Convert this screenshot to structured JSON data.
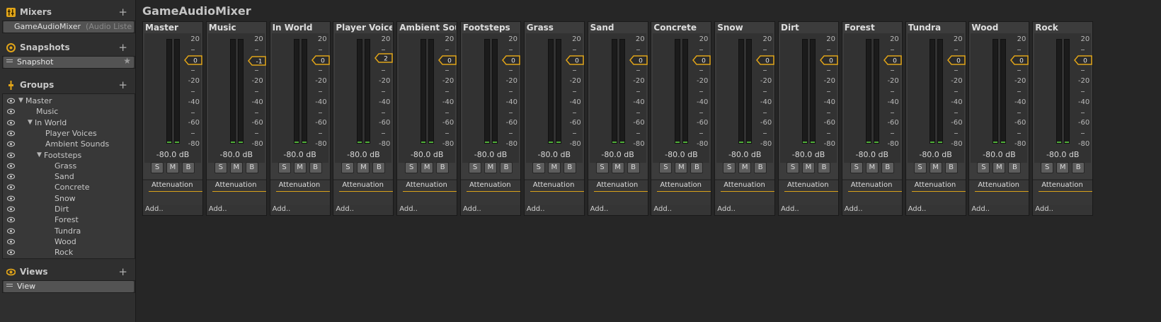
{
  "sections": {
    "mixers": {
      "title": "Mixers",
      "plus": "+",
      "item": "GameAudioMixer",
      "item_sub": "(Audio Liste"
    },
    "snapshots": {
      "title": "Snapshots",
      "plus": "+",
      "item": "Snapshot",
      "star": "★"
    },
    "groups": {
      "title": "Groups",
      "plus": "+",
      "items": [
        {
          "label": "Master",
          "indent": 0,
          "arrow": "▼"
        },
        {
          "label": "Music",
          "indent": 1,
          "arrow": ""
        },
        {
          "label": "In World",
          "indent": 1,
          "arrow": "▼"
        },
        {
          "label": "Player Voices",
          "indent": 2,
          "arrow": ""
        },
        {
          "label": "Ambient Sounds",
          "indent": 2,
          "arrow": ""
        },
        {
          "label": "Footsteps",
          "indent": 2,
          "arrow": "▼"
        },
        {
          "label": "Grass",
          "indent": 3,
          "arrow": ""
        },
        {
          "label": "Sand",
          "indent": 3,
          "arrow": ""
        },
        {
          "label": "Concrete",
          "indent": 3,
          "arrow": ""
        },
        {
          "label": "Snow",
          "indent": 3,
          "arrow": ""
        },
        {
          "label": "Dirt",
          "indent": 3,
          "arrow": ""
        },
        {
          "label": "Forest",
          "indent": 3,
          "arrow": ""
        },
        {
          "label": "Tundra",
          "indent": 3,
          "arrow": ""
        },
        {
          "label": "Wood",
          "indent": 3,
          "arrow": ""
        },
        {
          "label": "Rock",
          "indent": 3,
          "arrow": ""
        }
      ]
    },
    "views": {
      "title": "Views",
      "plus": "+",
      "item": "View"
    }
  },
  "mixer_title": "GameAudioMixer",
  "scale_labels": [
    "20",
    "0",
    "-20",
    "-40",
    "-60",
    "-80"
  ],
  "db_readout": "-80.0 dB",
  "buttons": {
    "solo": "S",
    "mute": "M",
    "bypass": "B"
  },
  "effect": "Attenuation",
  "add_label": "Add..",
  "strips": [
    {
      "name": "Master",
      "fader": "0"
    },
    {
      "name": "Music",
      "fader": "-1"
    },
    {
      "name": "In World",
      "fader": "0"
    },
    {
      "name": "Player Voice",
      "fader": "2"
    },
    {
      "name": "Ambient Sou",
      "fader": "0"
    },
    {
      "name": "Footsteps",
      "fader": "0"
    },
    {
      "name": "Grass",
      "fader": "0"
    },
    {
      "name": "Sand",
      "fader": "0"
    },
    {
      "name": "Concrete",
      "fader": "0"
    },
    {
      "name": "Snow",
      "fader": "0"
    },
    {
      "name": "Dirt",
      "fader": "0"
    },
    {
      "name": "Forest",
      "fader": "0"
    },
    {
      "name": "Tundra",
      "fader": "0"
    },
    {
      "name": "Wood",
      "fader": "0"
    },
    {
      "name": "Rock",
      "fader": "0"
    }
  ],
  "colors": {
    "accent": "#e0a419",
    "meter_green": "#4fae38"
  }
}
